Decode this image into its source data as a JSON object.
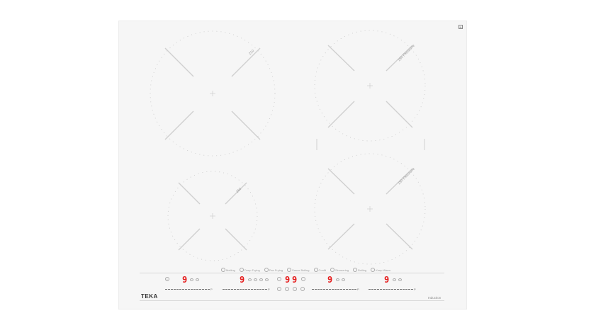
{
  "brand": "TEKA",
  "technology_label": "Induction",
  "zones": [
    {
      "id": "front-left-large",
      "label": "210"
    },
    {
      "id": "rear-right",
      "label": "180 Flexizone"
    },
    {
      "id": "rear-small",
      "label": "160"
    },
    {
      "id": "front-right",
      "label": "180 Flexizone"
    }
  ],
  "functions": [
    "Melting",
    "Deep Frying",
    "Pan Frying",
    "Sauce Boiling",
    "Confit",
    "Simmering",
    "Boiling",
    "Keep Warm"
  ],
  "displays": {
    "zone1": "9",
    "timer_a": "9",
    "timer_b": "9",
    "timer_c": "9",
    "zone3": "9",
    "zone4": "9"
  },
  "slider_end_label": "P",
  "colors": {
    "display": "#e51c1c",
    "glass": "#f6f6f6"
  }
}
